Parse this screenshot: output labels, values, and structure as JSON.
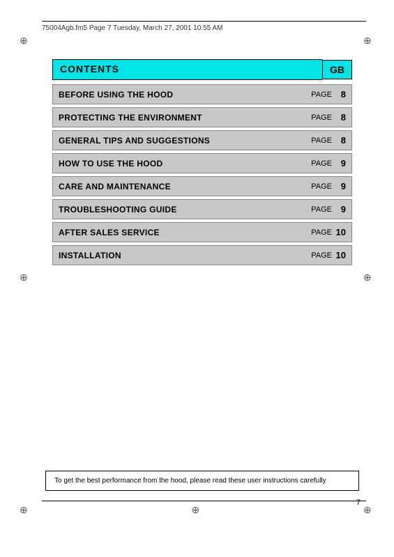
{
  "header": {
    "filename": "75004Agb.fm5  Page 7  Tuesday, March 27, 2001  10:55 AM"
  },
  "contents": {
    "title": "CONTENTS",
    "gb_label": "GB",
    "rows": [
      {
        "title": "BEFORE USING THE HOOD",
        "page_label": "PAGE",
        "page_num": "8"
      },
      {
        "title": "PROTECTING THE ENVIRONMENT",
        "page_label": "PAGE",
        "page_num": "8"
      },
      {
        "title": "GENERAL TIPS AND SUGGESTIONS",
        "page_label": "PAGE",
        "page_num": "8"
      },
      {
        "title": "HOW TO USE THE HOOD",
        "page_label": "PAGE",
        "page_num": "9"
      },
      {
        "title": "CARE AND MAINTENANCE",
        "page_label": "PAGE",
        "page_num": "9"
      },
      {
        "title": "TROUBLESHOOTING GUIDE",
        "page_label": "PAGE",
        "page_num": "9"
      },
      {
        "title": "AFTER SALES SERVICE",
        "page_label": "PAGE",
        "page_num": "10"
      },
      {
        "title": "INSTALLATION",
        "page_label": "PAGE",
        "page_num": "10"
      }
    ]
  },
  "bottom_note": "To get the best performance from the hood, please read these user instructions carefully",
  "page_number": "7"
}
